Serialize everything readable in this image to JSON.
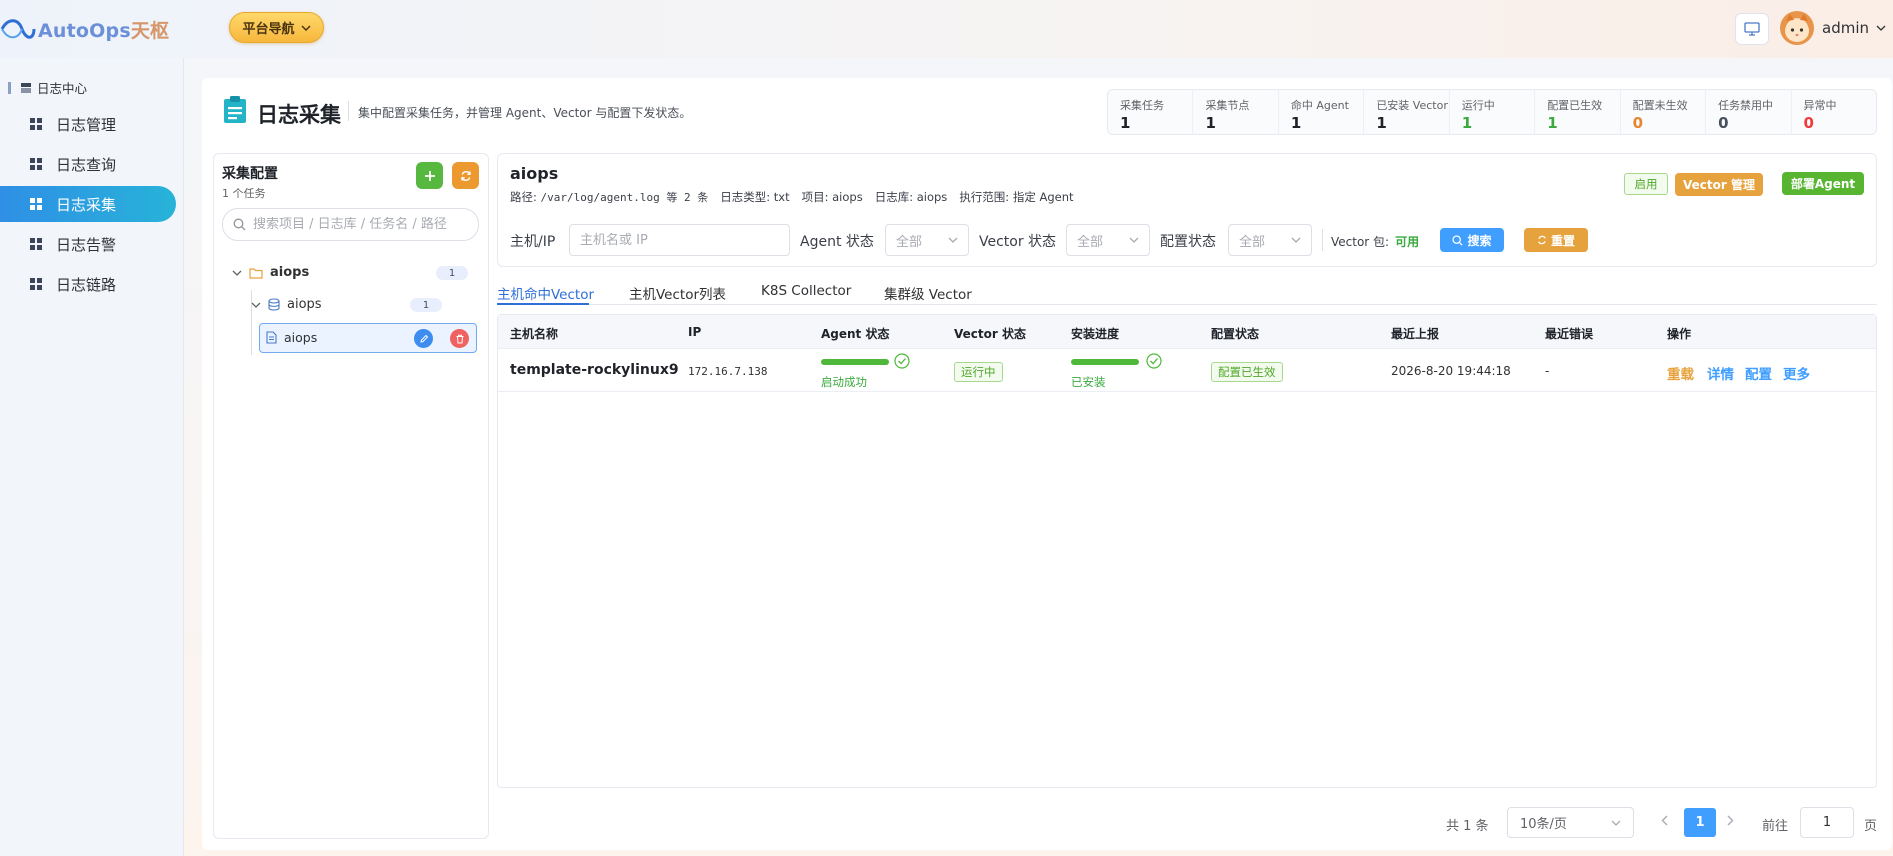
{
  "app": {
    "brand_en": "AutoOps",
    "brand_cn": "天枢"
  },
  "header": {
    "platform_nav": "平台导航",
    "username": "admin"
  },
  "sidebar": {
    "group": "日志中心",
    "items": [
      {
        "label": "日志管理"
      },
      {
        "label": "日志查询"
      },
      {
        "label": "日志采集"
      },
      {
        "label": "日志告警"
      },
      {
        "label": "日志链路"
      }
    ]
  },
  "page": {
    "title": "日志采集",
    "description": "集中配置采集任务，并管理 Agent、Vector 与配置下发状态。"
  },
  "stats": [
    {
      "label": "采集任务",
      "value": "1",
      "color": "#1f2329"
    },
    {
      "label": "采集节点",
      "value": "1",
      "color": "#1f2329"
    },
    {
      "label": "命中 Agent",
      "value": "1",
      "color": "#1f2329"
    },
    {
      "label": "已安装 Vector",
      "value": "1",
      "color": "#1f2329"
    },
    {
      "label": "运行中",
      "value": "1",
      "color": "#3aaa3e"
    },
    {
      "label": "配置已生效",
      "value": "1",
      "color": "#3aaa3e"
    },
    {
      "label": "配置未生效",
      "value": "0",
      "color": "#e6862f"
    },
    {
      "label": "任务禁用中",
      "value": "0",
      "color": "#48505c"
    },
    {
      "label": "异常中",
      "value": "0",
      "color": "#ef3b3b"
    }
  ],
  "tree": {
    "title": "采集配置",
    "subtitle": "1 个任务",
    "search_placeholder": "搜索项目 / 日志库 / 任务名 / 路径",
    "project": {
      "label": "aiops",
      "count": "1"
    },
    "store": {
      "label": "aiops",
      "count": "1"
    },
    "task": {
      "label": "aiops"
    }
  },
  "task": {
    "name": "aiops",
    "path_label": "路径:",
    "path_value": "/var/log/agent.log 等 2 条",
    "type_label": "日志类型:",
    "type_value": "txt",
    "project_label": "项目:",
    "project_value": "aiops",
    "store_label": "日志库:",
    "store_value": "aiops",
    "scope_label": "执行范围:",
    "scope_value": "指定 Agent",
    "status_tag": "启用",
    "vector_btn": "Vector 管理",
    "deploy_btn": "部署Agent"
  },
  "filters": {
    "host_label": "主机/IP",
    "host_placeholder": "主机名或 IP",
    "agent_label": "Agent 状态",
    "agent_value": "全部",
    "vector_label": "Vector 状态",
    "vector_value": "全部",
    "config_label": "配置状态",
    "config_value": "全部",
    "vector_pkg_label": "Vector 包:",
    "vector_pkg_value": "可用",
    "search_btn": "搜索",
    "reset_btn": "重置"
  },
  "tabs": [
    {
      "label": "主机命中Vector"
    },
    {
      "label": "主机Vector列表"
    },
    {
      "label": "K8S Collector"
    },
    {
      "label": "集群级 Vector"
    }
  ],
  "table": {
    "columns": [
      "主机名称",
      "IP",
      "Agent 状态",
      "Vector 状态",
      "安装进度",
      "配置状态",
      "最近上报",
      "最近错误",
      "操作"
    ],
    "rows": [
      {
        "host": "template-rockylinux9",
        "ip": "172.16.7.138",
        "agent_status": "启动成功",
        "vector_status": "运行中",
        "install_status": "已安装",
        "config_status": "配置已生效",
        "last_report": "2026-8-20 19:44:18",
        "last_error": "-",
        "ops": [
          "重载",
          "详情",
          "配置",
          "更多"
        ]
      }
    ]
  },
  "pagination": {
    "total": "共 1 条",
    "page_size": "10条/页",
    "current": "1",
    "goto_label": "前往",
    "goto_value": "1",
    "page_suffix": "页"
  }
}
